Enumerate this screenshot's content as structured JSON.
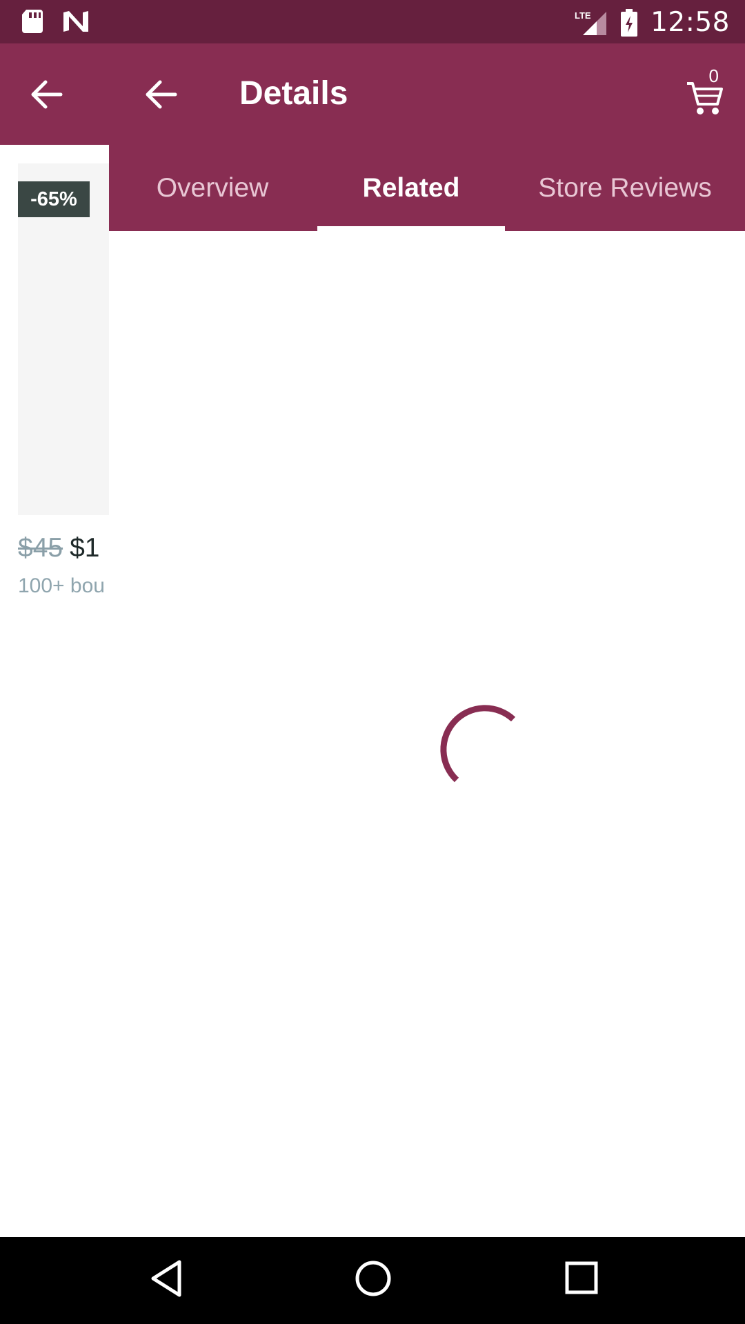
{
  "status_bar": {
    "time": "12:58",
    "network": "LTE",
    "icons": [
      "sd-card-icon",
      "n-app-icon",
      "lte-signal-icon",
      "battery-charging-icon"
    ]
  },
  "background_card": {
    "discount_badge": "-65%",
    "old_price": "$45",
    "new_price": "$1",
    "sold_text": "100+ bou"
  },
  "toolbar": {
    "title": "Details",
    "cart_count": "0"
  },
  "tabs": [
    {
      "label": "Overview",
      "selected": false
    },
    {
      "label": "Related",
      "selected": true
    },
    {
      "label": "Store Reviews",
      "selected": false
    }
  ],
  "colors": {
    "status_bar": "#66203E",
    "toolbar": "#882D52",
    "spinner": "#882D52",
    "badge": "#3A4744"
  },
  "loading": true
}
